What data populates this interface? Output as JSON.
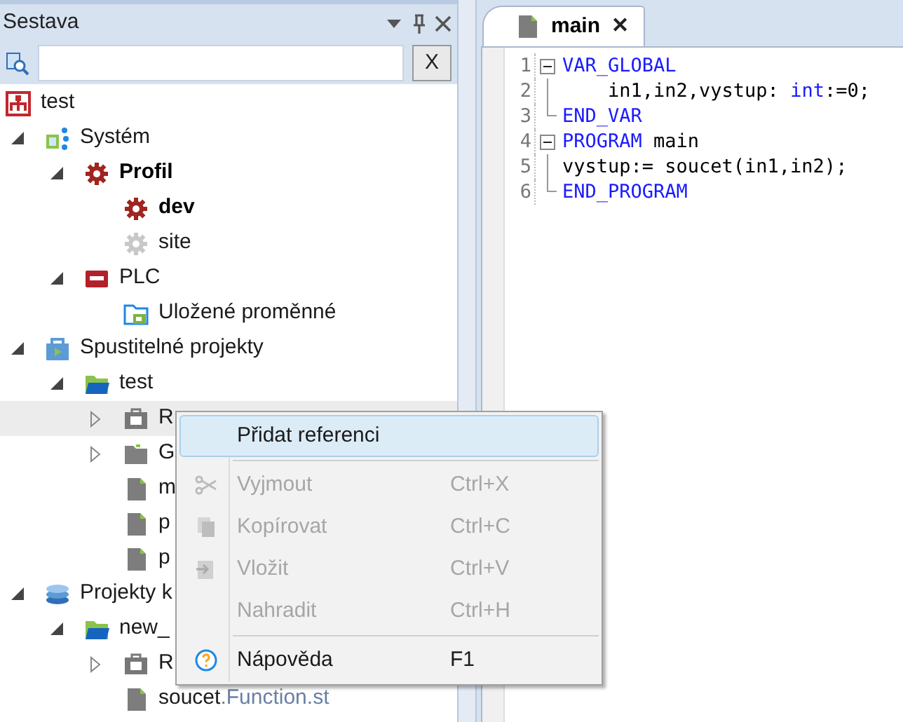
{
  "panel": {
    "title": "Sestava",
    "clear_button": "X"
  },
  "tree": [
    {
      "label": "test",
      "kind": "system-root",
      "children": [
        {
          "label": "Systém",
          "kind": "network",
          "expanded": true,
          "children": [
            {
              "label": "Profil",
              "kind": "gear-red",
              "expanded": true,
              "active": true,
              "children": [
                {
                  "label": "dev",
                  "kind": "gear-red",
                  "active": true
                },
                {
                  "label": "site",
                  "kind": "gear-grey",
                  "active": false
                }
              ]
            },
            {
              "label": "PLC",
              "kind": "plc",
              "expanded": true,
              "children": [
                {
                  "label": "Uložené proměnné",
                  "kind": "folder-save"
                }
              ]
            }
          ]
        },
        {
          "label": "Spustitelné projekty",
          "kind": "package",
          "expanded": true,
          "children": [
            {
              "label": "test",
              "kind": "folder-open",
              "expanded": true,
              "children": [
                {
                  "label": "R",
                  "kind": "refs",
                  "expanded": false,
                  "hovered": true
                },
                {
                  "label": "G",
                  "kind": "folder",
                  "expanded": false
                },
                {
                  "label": "m",
                  "kind": "file"
                },
                {
                  "label": "p",
                  "kind": "file"
                },
                {
                  "label": "p",
                  "kind": "file"
                }
              ]
            }
          ]
        },
        {
          "label": "Projekty k",
          "kind": "library",
          "expanded": true,
          "children": [
            {
              "label": "new_",
              "kind": "folder-open",
              "expanded": true,
              "children": [
                {
                  "label": "R",
                  "kind": "refs",
                  "expanded": false
                },
                {
                  "label": "soucet",
                  "suffix": ".Function.st",
                  "kind": "file"
                }
              ]
            }
          ]
        }
      ]
    }
  ],
  "editor": {
    "tabs": [
      {
        "label": "main",
        "selected": true,
        "close": "✕"
      }
    ],
    "blocks": [
      {
        "lines": [
          {
            "number": "1",
            "tokens": [
              {
                "kind": "keyword",
                "text": "VAR_GLOBAL"
              }
            ]
          },
          {
            "number": "2",
            "tokens": [
              {
                "kind": "plain",
                "text": "    in1,in2,vystup: "
              },
              {
                "kind": "keyword",
                "text": "int"
              },
              {
                "kind": "plain",
                "text": ":=0;"
              }
            ]
          },
          {
            "number": "3",
            "tokens": [
              {
                "kind": "keyword",
                "text": "END_VAR"
              }
            ]
          }
        ]
      },
      {
        "lines": [
          {
            "number": "4",
            "tokens": [
              {
                "kind": "keyword",
                "text": "PROGRAM"
              },
              {
                "kind": "plain",
                "text": " main"
              }
            ]
          },
          {
            "number": "5",
            "tokens": [
              {
                "kind": "plain",
                "text": "vystup:= soucet(in1,in2);"
              }
            ]
          },
          {
            "number": "6",
            "tokens": [
              {
                "kind": "keyword",
                "text": "END_PROGRAM"
              }
            ]
          }
        ]
      }
    ]
  },
  "context_menu": [
    [
      {
        "kind": "none",
        "label": "Přidat referenci",
        "highlighted": true,
        "disabled": false
      }
    ],
    [
      {
        "kind": "scissors",
        "label": "Vyjmout",
        "shortcut": "Ctrl+X",
        "highlighted": false,
        "disabled": true
      },
      {
        "kind": "copy",
        "label": "Kopírovat",
        "shortcut": "Ctrl+C",
        "highlighted": false,
        "disabled": true
      },
      {
        "kind": "paste",
        "label": "Vložit",
        "shortcut": "Ctrl+V",
        "highlighted": false,
        "disabled": true
      },
      {
        "kind": "none",
        "label": "Nahradit",
        "shortcut": "Ctrl+H",
        "highlighted": false,
        "disabled": true
      }
    ],
    [
      {
        "kind": "help",
        "label": "Nápověda",
        "shortcut": "F1",
        "highlighted": false,
        "disabled": false
      }
    ]
  ]
}
